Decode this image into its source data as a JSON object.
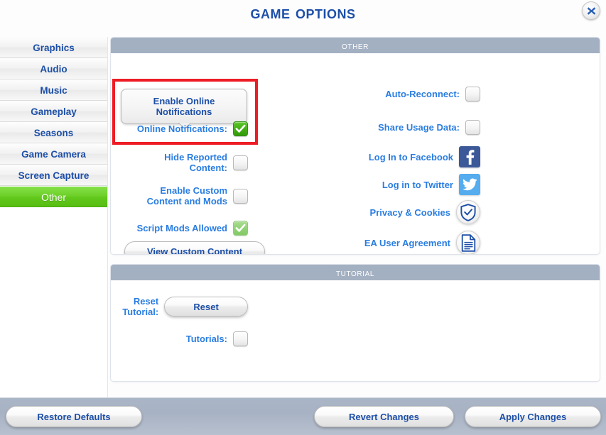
{
  "header": {
    "title": "Game Options",
    "close_label": "Close",
    "close_icon": "close-x-icon"
  },
  "sidebar": {
    "items": [
      {
        "label": "Graphics",
        "active": false
      },
      {
        "label": "Audio",
        "active": false
      },
      {
        "label": "Music",
        "active": false
      },
      {
        "label": "Gameplay",
        "active": false
      },
      {
        "label": "Seasons",
        "active": false
      },
      {
        "label": "Game Camera",
        "active": false
      },
      {
        "label": "Screen Capture",
        "active": false
      },
      {
        "label": "Other",
        "active": true
      }
    ],
    "active_item": "Other"
  },
  "tooltip": {
    "text": "Enable Online Notifications",
    "visible": true
  },
  "annotation": {
    "color": "#ee1c25",
    "target": "Online Notifications row and tooltip"
  },
  "sections": {
    "other": {
      "title": "Other",
      "left_column": {
        "online_notifications": {
          "label": "Online Notifications:",
          "state": "checked",
          "icon": "checkbox-checked-icon"
        },
        "hide_reported_content": {
          "label": "Hide Reported Content:",
          "state": "unchecked",
          "icon": "checkbox-unchecked-icon"
        },
        "enable_custom_content": {
          "label": "Enable Custom Content and Mods",
          "state": "unchecked",
          "icon": "checkbox-unchecked-icon"
        },
        "script_mods_allowed": {
          "label": "Script Mods Allowed",
          "state": "checked-disabled",
          "icon": "checkbox-checked-disabled-icon"
        },
        "view_custom_content_button": "View Custom Content"
      },
      "right_column": {
        "auto_reconnect": {
          "label": "Auto-Reconnect:",
          "state": "unchecked",
          "icon": "checkbox-unchecked-icon"
        },
        "share_usage_data": {
          "label": "Share Usage Data:",
          "state": "unchecked",
          "icon": "checkbox-unchecked-icon"
        },
        "facebook": {
          "label": "Log In to Facebook",
          "icon": "facebook-icon",
          "color": "#3b5998"
        },
        "twitter": {
          "label": "Log in to Twitter",
          "icon": "twitter-icon",
          "color": "#55acee"
        },
        "privacy_cookies": {
          "label": "Privacy & Cookies",
          "icon": "shield-check-icon"
        },
        "ea_user_agreement": {
          "label": "EA User Agreement",
          "icon": "document-icon"
        }
      }
    },
    "tutorial": {
      "title": "Tutorial",
      "reset_tutorial": {
        "label": "Reset Tutorial:",
        "button_label": "Reset"
      },
      "tutorials": {
        "label": "Tutorials:",
        "state": "unchecked",
        "icon": "checkbox-unchecked-icon"
      }
    }
  },
  "footer": {
    "restore_defaults": "Restore Defaults",
    "revert_changes": "Revert Changes",
    "apply_changes": "Apply Changes"
  },
  "colors": {
    "accent_blue": "#1d4fa8",
    "label_blue": "#2a7de1",
    "section_header": "#a3b0c2",
    "active_nav_green": "#62c81c",
    "annotation_red": "#ee1c25",
    "footer_bar": "#a7b2c4"
  }
}
